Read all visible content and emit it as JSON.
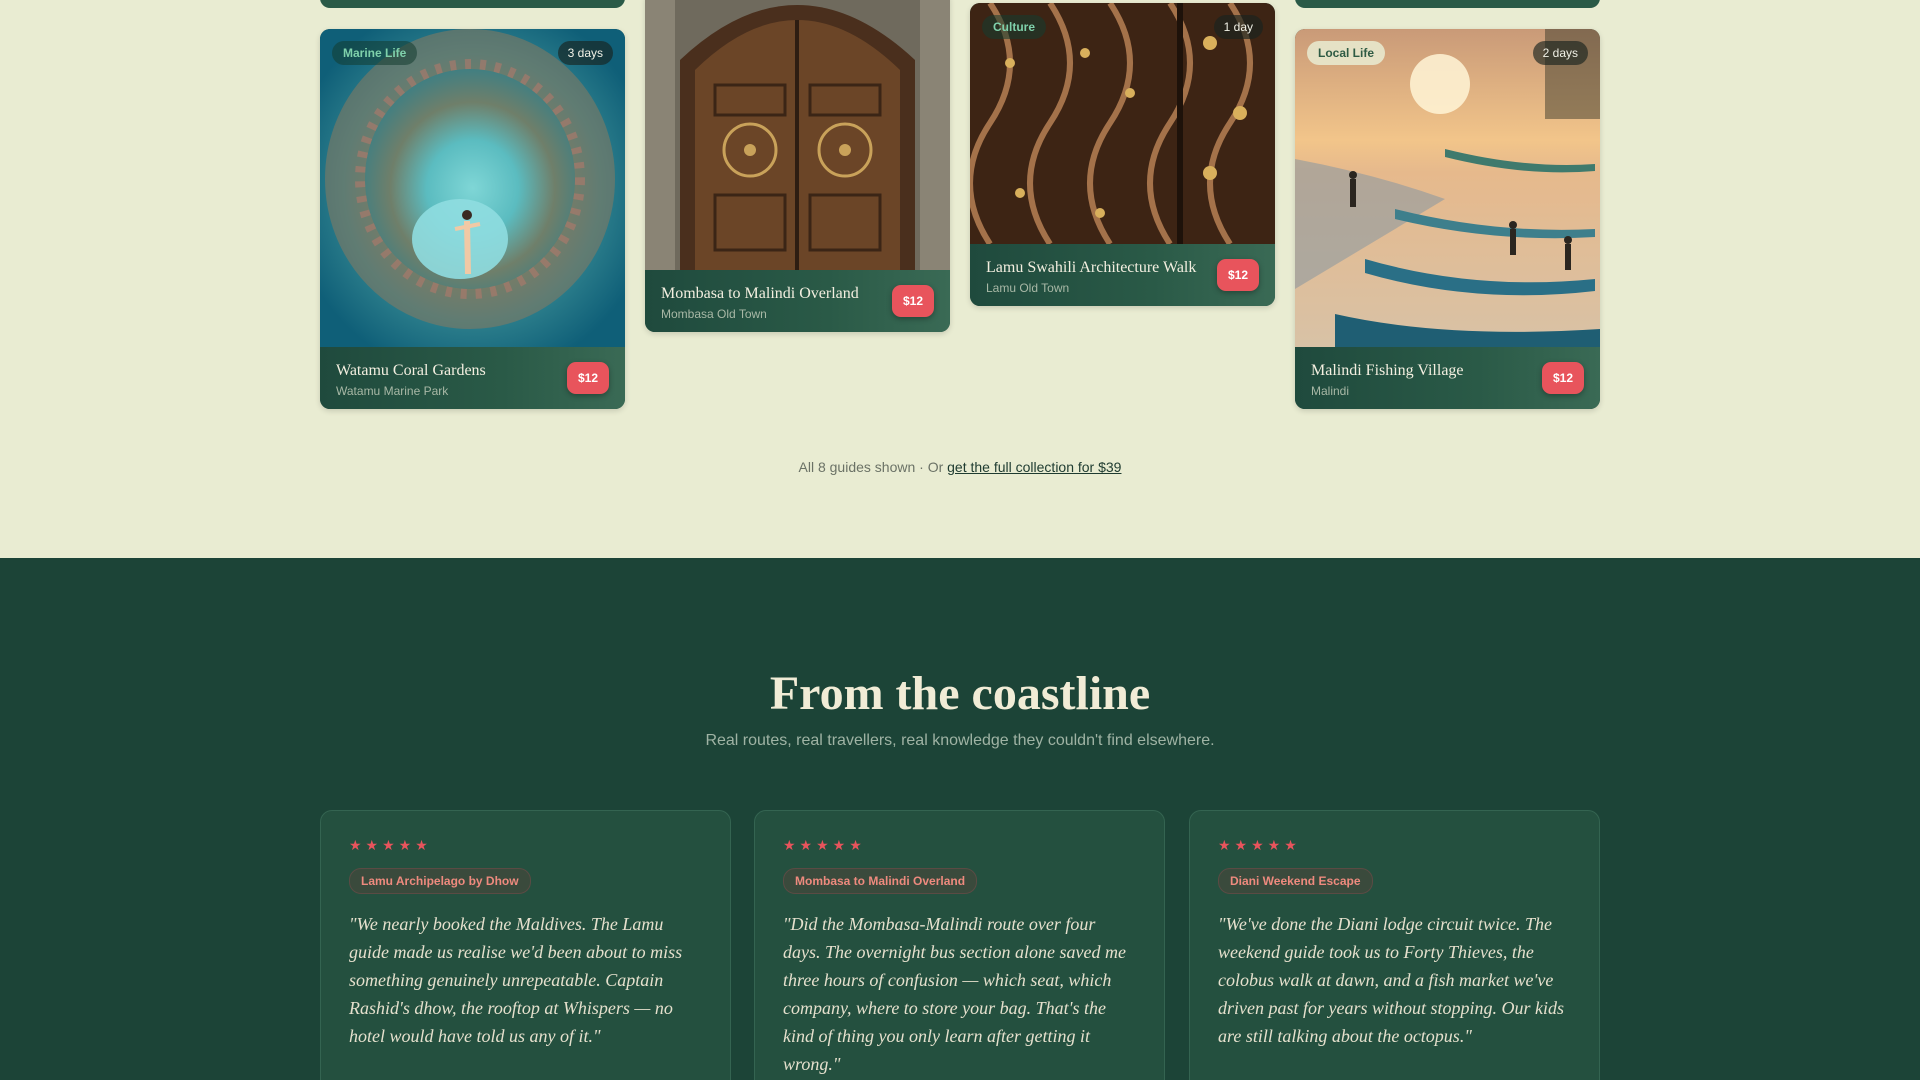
{
  "guides": [
    {
      "tag": "Marine Life",
      "duration": "3 days",
      "title": "Watamu Coral Gardens",
      "location": "Watamu Marine Park",
      "price": "$12"
    },
    {
      "title": "Mombasa to Malindi Overland",
      "location": "Mombasa Old Town",
      "price": "$12"
    },
    {
      "tag": "Culture",
      "duration": "1 day",
      "title": "Lamu Swahili Architecture Walk",
      "location": "Lamu Old Town",
      "price": "$12"
    },
    {
      "tag": "Local Life",
      "duration": "2 days",
      "title": "Malindi Fishing Village",
      "location": "Malindi",
      "price": "$12"
    }
  ],
  "collection": {
    "text": "All 8 guides shown · Or",
    "link": "get the full collection for $39"
  },
  "coastline": {
    "title": "From the coastline",
    "subtitle": "Real routes, real travellers, real knowledge they couldn't find elsewhere.",
    "reviews": [
      {
        "stars": "★★★★★",
        "rating": 5,
        "route": "Lamu Archipelago by Dhow",
        "quote": "\"We nearly booked the Maldives. The Lamu guide made us realise we'd been about to miss something genuinely unrepeatable. Captain Rashid's dhow, the rooftop at Whispers — no hotel would have told us any of it.\""
      },
      {
        "stars": "★★★★★",
        "rating": 5,
        "route": "Mombasa to Malindi Overland",
        "quote": "\"Did the Mombasa-Malindi route over four days. The overnight bus section alone saved me three hours of confusion — which seat, which company, where to store your bag. That's the kind of thing you only learn after getting it wrong.\""
      },
      {
        "stars": "★★★★★",
        "rating": 5,
        "route": "Diani Weekend Escape",
        "quote": "\"We've done the Diani lodge circuit twice. The weekend guide took us to Forty Thieves, the colobus walk at dawn, and a fish market we've driven past for years without stopping. Our kids are still talking about the octopus.\""
      }
    ]
  }
}
